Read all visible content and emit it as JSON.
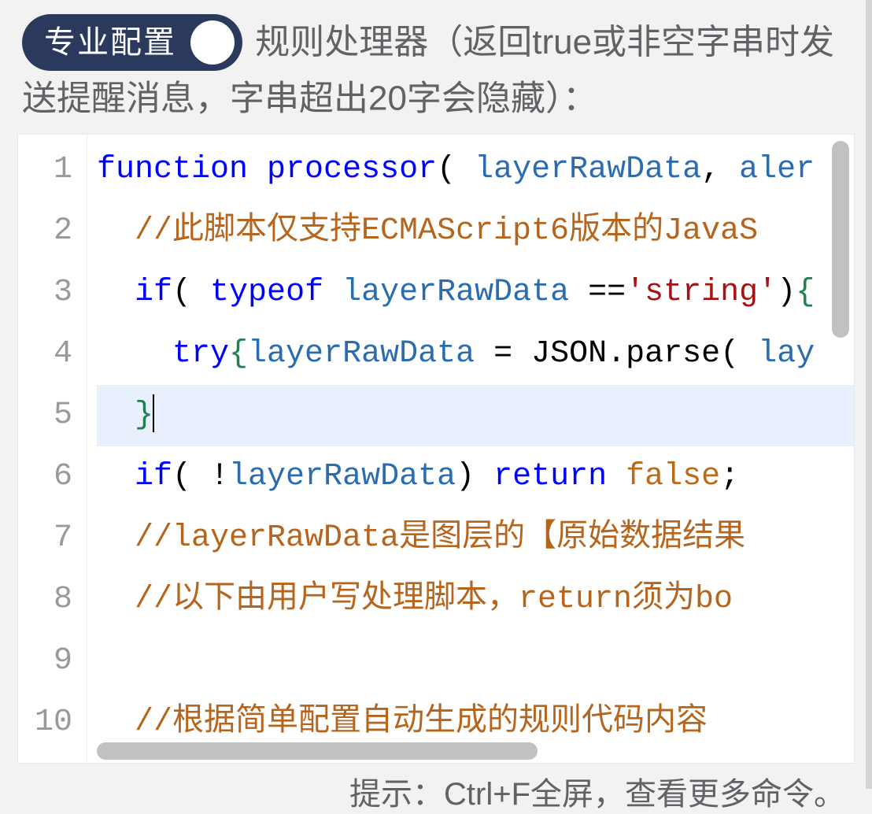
{
  "header": {
    "badge_label": "专业配置",
    "title": "规则处理器（返回true或非空字串时发送提醒消息，字串超出20字会隐藏）："
  },
  "editor": {
    "active_line_index": 4,
    "code_raw": "function processor( layerRawData, aler\n  //此脚本仅支持ECMAScript6版本的JavaS\n  if( typeof layerRawData =='string'){\n    try{layerRawData = JSON.parse( lay\n  }\n  if( !layerRawData) return false;\n  //layerRawData是图层的【原始数据结果\n  //以下由用户写处理脚本，return须为bo\n\n  //根据简单配置自动生成的规则代码内容",
    "tokens": [
      [
        {
          "t": "function",
          "c": "kw"
        },
        {
          "t": " ",
          "c": "op"
        },
        {
          "t": "processor",
          "c": "def"
        },
        {
          "t": "( ",
          "c": "op"
        },
        {
          "t": "layerRawData",
          "c": "varbl"
        },
        {
          "t": ", ",
          "c": "op"
        },
        {
          "t": "aler",
          "c": "varbl"
        }
      ],
      [
        {
          "t": "  ",
          "c": "op"
        },
        {
          "t": "//此脚本仅支持ECMAScript6版本的JavaS",
          "c": "com"
        }
      ],
      [
        {
          "t": "  ",
          "c": "op"
        },
        {
          "t": "if",
          "c": "kw"
        },
        {
          "t": "( ",
          "c": "op"
        },
        {
          "t": "typeof",
          "c": "kw"
        },
        {
          "t": " ",
          "c": "op"
        },
        {
          "t": "layerRawData",
          "c": "varbl"
        },
        {
          "t": " ==",
          "c": "op"
        },
        {
          "t": "'string'",
          "c": "str"
        },
        {
          "t": ")",
          "c": "op"
        },
        {
          "t": "{",
          "c": "brace"
        }
      ],
      [
        {
          "t": "    ",
          "c": "op"
        },
        {
          "t": "try",
          "c": "kw"
        },
        {
          "t": "{",
          "c": "brace"
        },
        {
          "t": "layerRawData",
          "c": "varbl"
        },
        {
          "t": " = ",
          "c": "op"
        },
        {
          "t": "JSON",
          "c": "op"
        },
        {
          "t": ".",
          "c": "op"
        },
        {
          "t": "parse",
          "c": "op"
        },
        {
          "t": "( ",
          "c": "op"
        },
        {
          "t": "lay",
          "c": "varbl"
        }
      ],
      [
        {
          "t": "  ",
          "c": "op"
        },
        {
          "t": "}",
          "c": "brace"
        }
      ],
      [
        {
          "t": "  ",
          "c": "op"
        },
        {
          "t": "if",
          "c": "kw"
        },
        {
          "t": "( !",
          "c": "op"
        },
        {
          "t": "layerRawData",
          "c": "varbl"
        },
        {
          "t": ") ",
          "c": "op"
        },
        {
          "t": "return",
          "c": "kw"
        },
        {
          "t": " ",
          "c": "op"
        },
        {
          "t": "false",
          "c": "false"
        },
        {
          "t": ";",
          "c": "op"
        }
      ],
      [
        {
          "t": "  ",
          "c": "op"
        },
        {
          "t": "//layerRawData是图层的【原始数据结果",
          "c": "com"
        }
      ],
      [
        {
          "t": "  ",
          "c": "op"
        },
        {
          "t": "//以下由用户写处理脚本，return须为bo",
          "c": "com"
        }
      ],
      [],
      [
        {
          "t": "  ",
          "c": "op"
        },
        {
          "t": "//根据简单配置自动生成的规则代码内容",
          "c": "com"
        }
      ]
    ]
  },
  "hint": "提示：Ctrl+F全屏，查看更多命令。"
}
